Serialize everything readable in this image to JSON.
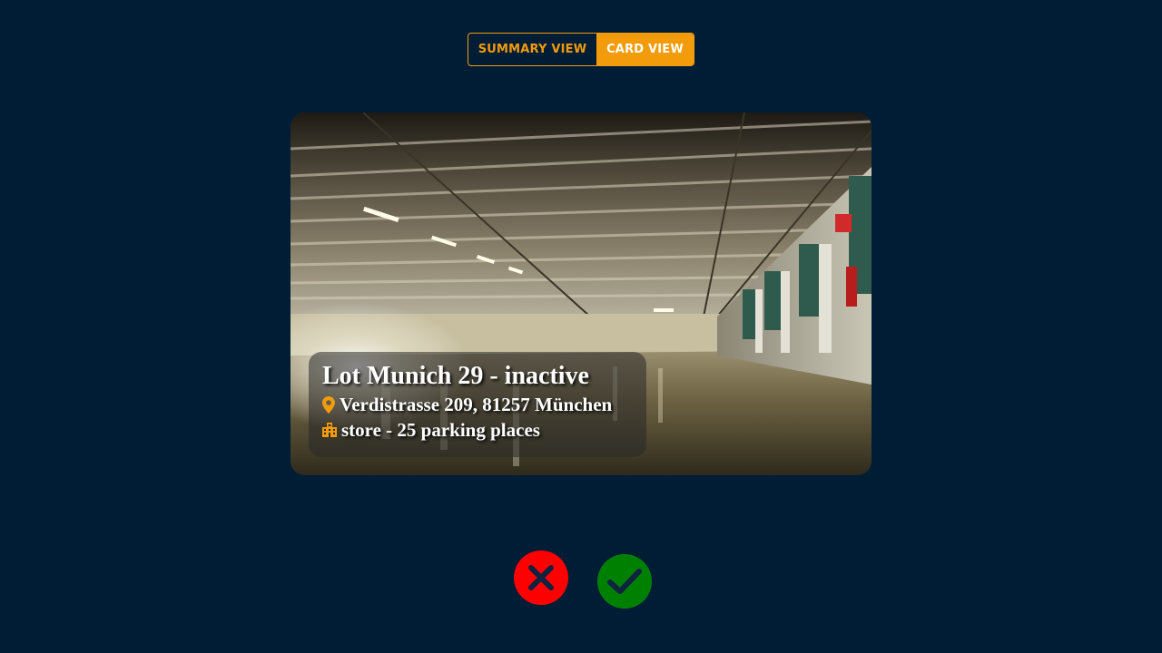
{
  "view_toggle": {
    "summary_label": "SUMMARY VIEW",
    "card_label": "CARD VIEW",
    "active": "card"
  },
  "card": {
    "title": "Lot Munich 29 - inactive",
    "address": "Verdistrasse 209, 81257 München",
    "details": "store - 25 parking places",
    "address_icon": "map-pin-icon",
    "details_icon": "building-icon",
    "photo_subject": "underground parking garage"
  },
  "actions": {
    "reject_icon": "close-icon",
    "accept_icon": "check-icon"
  },
  "colors": {
    "background": "#001d36",
    "accent": "#f29b0b",
    "reject": "#ff0000",
    "accept": "#008000",
    "icon_dark": "#0f2340"
  }
}
